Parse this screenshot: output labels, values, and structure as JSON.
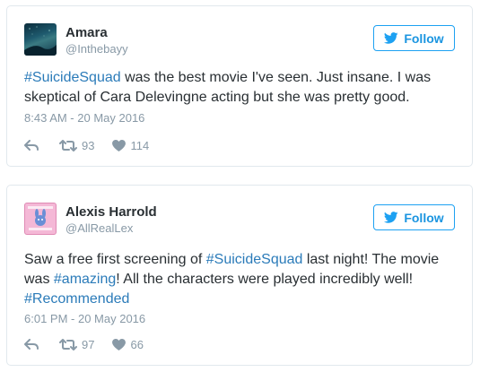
{
  "tweets": [
    {
      "name": "Amara",
      "handle": "@Inthebayy",
      "follow_label": "Follow",
      "text_parts": [
        {
          "text": "#SuicideSquad",
          "hashtag": true
        },
        {
          "text": " was the best movie I've seen. Just insane. I was skeptical of Cara Delevingne acting but she was pretty good.",
          "hashtag": false
        }
      ],
      "timestamp": "8:43 AM - 20 May 2016",
      "retweets": "93",
      "likes": "114",
      "avatar_icon": "night-sky-avatar"
    },
    {
      "name": "Alexis Harrold",
      "handle": "@AllRealLex",
      "follow_label": "Follow",
      "text_parts": [
        {
          "text": "Saw a free first screening of ",
          "hashtag": false
        },
        {
          "text": "#SuicideSquad",
          "hashtag": true
        },
        {
          "text": " last night! The movie was ",
          "hashtag": false
        },
        {
          "text": "#amazing",
          "hashtag": true
        },
        {
          "text": "! All the characters were played incredibly well! ",
          "hashtag": false
        },
        {
          "text": "#Recommended",
          "hashtag": true
        }
      ],
      "timestamp": "6:01 PM - 20 May 2016",
      "retweets": "97",
      "likes": "66",
      "avatar_icon": "pink-bunny-avatar"
    }
  ],
  "colors": {
    "accent": "#1da1f2",
    "link": "#2b7bb9",
    "text": "#292f33",
    "muted": "#8899a6",
    "border": "#e1e8ed"
  },
  "icons": {
    "follow": "bird-icon",
    "reply": "reply-arrow-icon",
    "retweet": "retweet-icon",
    "like": "heart-icon"
  }
}
